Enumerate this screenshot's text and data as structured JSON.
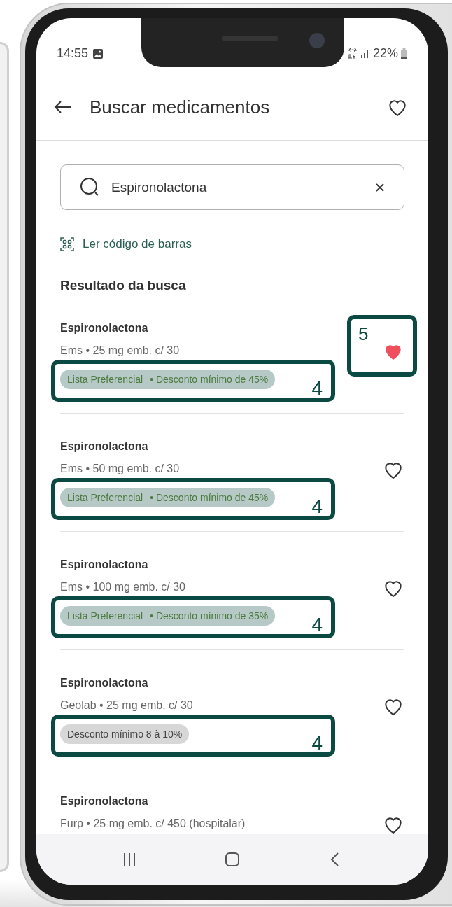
{
  "status_bar": {
    "time": "14:55",
    "battery": "22%"
  },
  "header": {
    "title": "Buscar medicamentos"
  },
  "search": {
    "value": "Espironolactona"
  },
  "barcode_link": "Ler código de barras",
  "section_title": "Resultado da busca",
  "results": [
    {
      "name": "Espironolactona",
      "detail": "Ems • 25 mg emb. c/ 30",
      "favorite": true,
      "tag": {
        "kind": "preferential",
        "parts": [
          "Lista Preferencial",
          "• Desconto mínimo de 45%"
        ]
      },
      "tag_callout": "4",
      "favorite_callout": "5"
    },
    {
      "name": "Espironolactona",
      "detail": "Ems • 50 mg emb. c/ 30",
      "favorite": false,
      "tag": {
        "kind": "preferential",
        "parts": [
          "Lista Preferencial",
          "• Desconto mínimo de 45%"
        ]
      },
      "tag_callout": "4"
    },
    {
      "name": "Espironolactona",
      "detail": "Ems • 100 mg emb. c/ 30",
      "favorite": false,
      "tag": {
        "kind": "preferential",
        "parts": [
          "Lista Preferencial",
          "• Desconto mínimo de 35%"
        ]
      },
      "tag_callout": "4"
    },
    {
      "name": "Espironolactona",
      "detail": "Geolab • 25 mg emb. c/ 30",
      "favorite": false,
      "tag": {
        "kind": "discount",
        "parts": [
          "Desconto mínimo 8 à 10%"
        ]
      },
      "tag_callout": "4"
    },
    {
      "name": "Espironolactona",
      "detail": "Furp • 25 mg emb. c/ 450 (hospitalar)",
      "favorite": false
    }
  ]
}
